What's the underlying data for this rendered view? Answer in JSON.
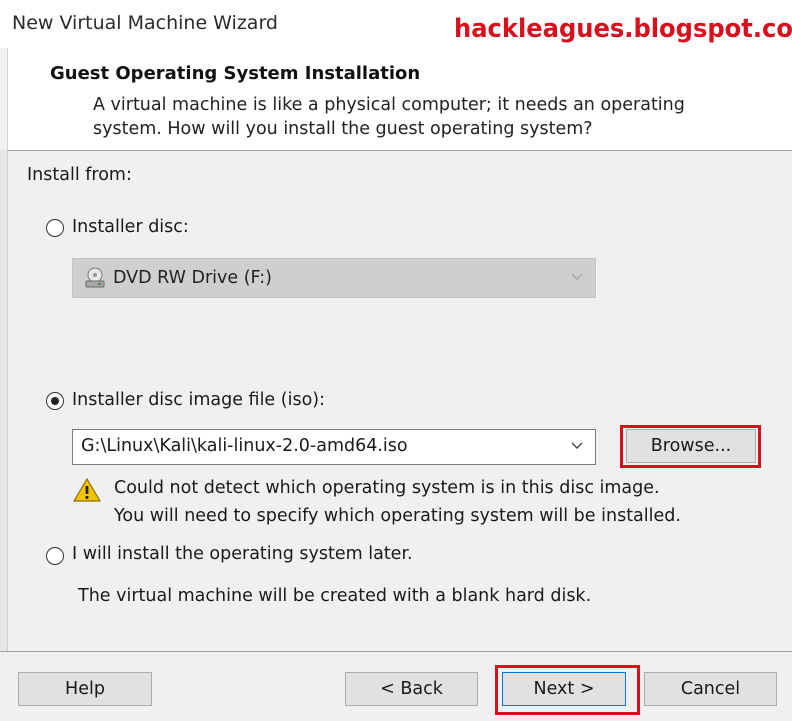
{
  "window": {
    "title": "New Virtual Machine Wizard"
  },
  "watermark": "hackleagues.blogspot.com",
  "header": {
    "title": "Guest Operating System Installation",
    "description_line1": "A virtual machine is like a physical computer; it needs an operating",
    "description_line2": "system. How will you install the guest operating system?"
  },
  "install_from": {
    "label": "Install from:",
    "options": [
      {
        "label": "Installer disc:",
        "selected": false
      },
      {
        "label": "Installer disc image file (iso):",
        "selected": true
      },
      {
        "label": "I will install the operating system later.",
        "selected": false
      }
    ],
    "disc_drive": {
      "selected": "DVD RW Drive (F:)",
      "enabled": false
    },
    "iso_path": {
      "value": "G:\\Linux\\Kali\\kali-linux-2.0-amd64.iso"
    },
    "browse_label": "Browse...",
    "warning_line1": "Could not detect which operating system is in this disc image.",
    "warning_line2": "You will need to specify which operating system will be installed.",
    "later_note": "The virtual machine will be created with a blank hard disk."
  },
  "buttons": {
    "help": "Help",
    "back": "< Back",
    "next": "Next >",
    "cancel": "Cancel"
  },
  "colors": {
    "highlight": "#d8101e",
    "warning_icon": "#f5c400"
  },
  "icons": [
    "disc-drive-icon",
    "warning-icon",
    "chevron-down-icon"
  ]
}
